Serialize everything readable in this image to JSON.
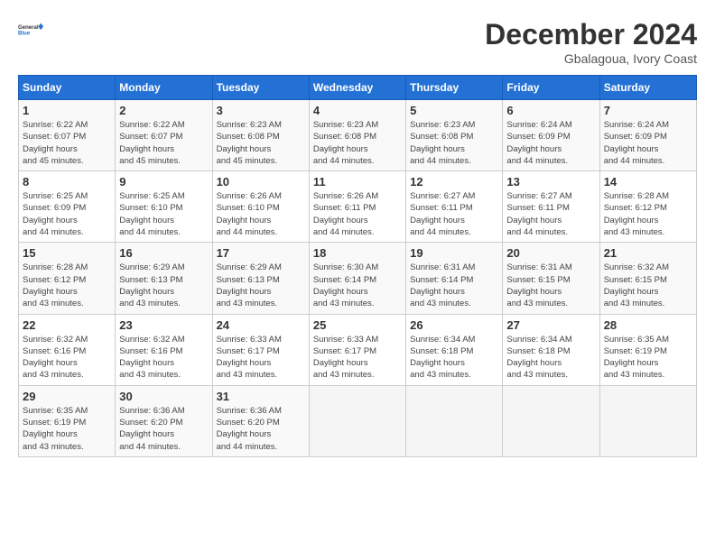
{
  "header": {
    "logo_general": "General",
    "logo_blue": "Blue",
    "month_title": "December 2024",
    "location": "Gbalagoua, Ivory Coast"
  },
  "calendar": {
    "days_of_week": [
      "Sunday",
      "Monday",
      "Tuesday",
      "Wednesday",
      "Thursday",
      "Friday",
      "Saturday"
    ],
    "weeks": [
      [
        null,
        null,
        null,
        null,
        null,
        null,
        null
      ]
    ],
    "cells": [
      {
        "day": null,
        "info": null
      },
      {
        "day": null,
        "info": null
      },
      {
        "day": null,
        "info": null
      },
      {
        "day": null,
        "info": null
      },
      {
        "day": null,
        "info": null
      },
      {
        "day": null,
        "info": null
      },
      {
        "day": null,
        "info": null
      }
    ]
  },
  "weeks": [
    [
      {
        "day": "1",
        "sunrise": "6:22 AM",
        "sunset": "6:07 PM",
        "daylight": "11 hours and 45 minutes."
      },
      {
        "day": "2",
        "sunrise": "6:22 AM",
        "sunset": "6:07 PM",
        "daylight": "11 hours and 45 minutes."
      },
      {
        "day": "3",
        "sunrise": "6:23 AM",
        "sunset": "6:08 PM",
        "daylight": "11 hours and 45 minutes."
      },
      {
        "day": "4",
        "sunrise": "6:23 AM",
        "sunset": "6:08 PM",
        "daylight": "11 hours and 44 minutes."
      },
      {
        "day": "5",
        "sunrise": "6:23 AM",
        "sunset": "6:08 PM",
        "daylight": "11 hours and 44 minutes."
      },
      {
        "day": "6",
        "sunrise": "6:24 AM",
        "sunset": "6:09 PM",
        "daylight": "11 hours and 44 minutes."
      },
      {
        "day": "7",
        "sunrise": "6:24 AM",
        "sunset": "6:09 PM",
        "daylight": "11 hours and 44 minutes."
      }
    ],
    [
      {
        "day": "8",
        "sunrise": "6:25 AM",
        "sunset": "6:09 PM",
        "daylight": "11 hours and 44 minutes."
      },
      {
        "day": "9",
        "sunrise": "6:25 AM",
        "sunset": "6:10 PM",
        "daylight": "11 hours and 44 minutes."
      },
      {
        "day": "10",
        "sunrise": "6:26 AM",
        "sunset": "6:10 PM",
        "daylight": "11 hours and 44 minutes."
      },
      {
        "day": "11",
        "sunrise": "6:26 AM",
        "sunset": "6:11 PM",
        "daylight": "11 hours and 44 minutes."
      },
      {
        "day": "12",
        "sunrise": "6:27 AM",
        "sunset": "6:11 PM",
        "daylight": "11 hours and 44 minutes."
      },
      {
        "day": "13",
        "sunrise": "6:27 AM",
        "sunset": "6:11 PM",
        "daylight": "11 hours and 44 minutes."
      },
      {
        "day": "14",
        "sunrise": "6:28 AM",
        "sunset": "6:12 PM",
        "daylight": "11 hours and 43 minutes."
      }
    ],
    [
      {
        "day": "15",
        "sunrise": "6:28 AM",
        "sunset": "6:12 PM",
        "daylight": "11 hours and 43 minutes."
      },
      {
        "day": "16",
        "sunrise": "6:29 AM",
        "sunset": "6:13 PM",
        "daylight": "11 hours and 43 minutes."
      },
      {
        "day": "17",
        "sunrise": "6:29 AM",
        "sunset": "6:13 PM",
        "daylight": "11 hours and 43 minutes."
      },
      {
        "day": "18",
        "sunrise": "6:30 AM",
        "sunset": "6:14 PM",
        "daylight": "11 hours and 43 minutes."
      },
      {
        "day": "19",
        "sunrise": "6:31 AM",
        "sunset": "6:14 PM",
        "daylight": "11 hours and 43 minutes."
      },
      {
        "day": "20",
        "sunrise": "6:31 AM",
        "sunset": "6:15 PM",
        "daylight": "11 hours and 43 minutes."
      },
      {
        "day": "21",
        "sunrise": "6:32 AM",
        "sunset": "6:15 PM",
        "daylight": "11 hours and 43 minutes."
      }
    ],
    [
      {
        "day": "22",
        "sunrise": "6:32 AM",
        "sunset": "6:16 PM",
        "daylight": "11 hours and 43 minutes."
      },
      {
        "day": "23",
        "sunrise": "6:32 AM",
        "sunset": "6:16 PM",
        "daylight": "11 hours and 43 minutes."
      },
      {
        "day": "24",
        "sunrise": "6:33 AM",
        "sunset": "6:17 PM",
        "daylight": "11 hours and 43 minutes."
      },
      {
        "day": "25",
        "sunrise": "6:33 AM",
        "sunset": "6:17 PM",
        "daylight": "11 hours and 43 minutes."
      },
      {
        "day": "26",
        "sunrise": "6:34 AM",
        "sunset": "6:18 PM",
        "daylight": "11 hours and 43 minutes."
      },
      {
        "day": "27",
        "sunrise": "6:34 AM",
        "sunset": "6:18 PM",
        "daylight": "11 hours and 43 minutes."
      },
      {
        "day": "28",
        "sunrise": "6:35 AM",
        "sunset": "6:19 PM",
        "daylight": "11 hours and 43 minutes."
      }
    ],
    [
      {
        "day": "29",
        "sunrise": "6:35 AM",
        "sunset": "6:19 PM",
        "daylight": "11 hours and 43 minutes."
      },
      {
        "day": "30",
        "sunrise": "6:36 AM",
        "sunset": "6:20 PM",
        "daylight": "11 hours and 44 minutes."
      },
      {
        "day": "31",
        "sunrise": "6:36 AM",
        "sunset": "6:20 PM",
        "daylight": "11 hours and 44 minutes."
      },
      null,
      null,
      null,
      null
    ]
  ]
}
